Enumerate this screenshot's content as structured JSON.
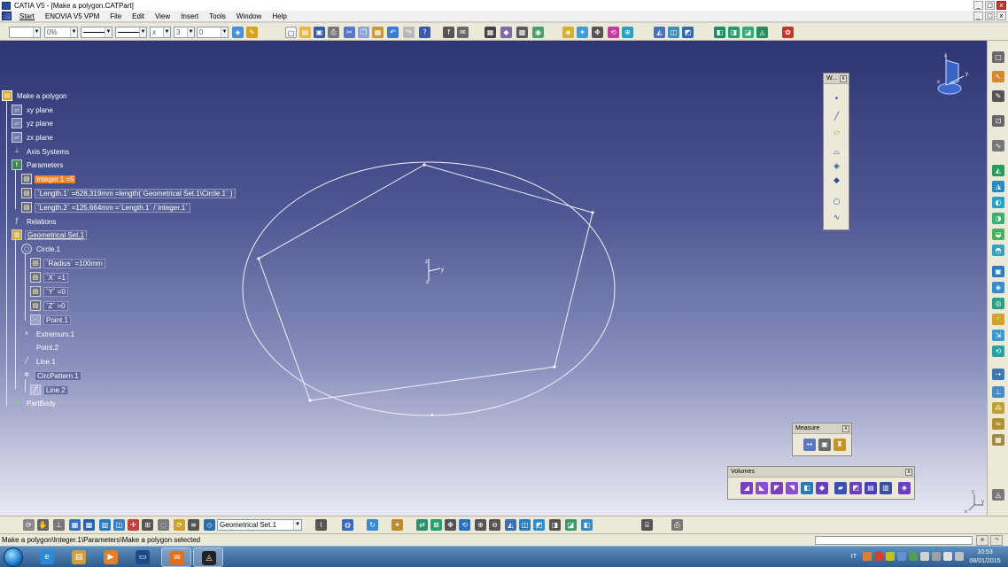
{
  "window": {
    "title": "CATIA V5 - [Make a polygon.CATPart]",
    "min": "_",
    "max": "□",
    "close": "x"
  },
  "menu": {
    "items": [
      "Start",
      "ENOVIA V5 VPM",
      "File",
      "Edit",
      "View",
      "Insert",
      "Tools",
      "Window",
      "Help"
    ]
  },
  "toolbar": {
    "transparency": "0%",
    "layer_value": "3",
    "thickness_value": "0",
    "none_value": "x"
  },
  "tree": {
    "root": "Make a polygon",
    "xy_plane": "xy plane",
    "yz_plane": "yz plane",
    "zx_plane": "zx plane",
    "axis_systems": "Axis Systems",
    "parameters": "Parameters",
    "integer1": "Integer.1 =5",
    "length1": "`Length.1` =628,319mm =length(`Geometrical Set.1\\Circle.1` )",
    "length2": "`Length.2` =125,664mm =`Length.1` /`Integer.1`",
    "relations": "Relations",
    "geometrical_set": "Geometrical Set.1",
    "circle1": "Circle.1",
    "radius": "`Radius` =100mm",
    "x": "`X` =1",
    "y": "`Y` =0",
    "z": "`Z` =0",
    "point1": "Point.1",
    "extremum1": "Extremum.1",
    "point2": "Point.2",
    "line1": "Line.1",
    "circpattern1": "CircPattern.1",
    "line2": "Line.2",
    "partbody": "PartBody"
  },
  "axis_labels": {
    "compass_x": "x",
    "compass_y": "y",
    "compass_z": "z",
    "origin_x": "x",
    "origin_y": "y",
    "origin_z": "z",
    "corner_x": "x",
    "corner_y": "y",
    "corner_z": "z"
  },
  "panels": {
    "wireframe_title": "W...",
    "measure_title": "Measure",
    "volumes_title": "Volumes",
    "close_glyph": "x"
  },
  "bottom_toolbar": {
    "current_set": "Geometrical Set.1"
  },
  "status": {
    "message": "Make a polygon\\Integer.1\\Parameters\\Make a polygon selected"
  },
  "taskbar": {
    "language": "IT",
    "time": "10:53",
    "date": "08/01/2015"
  },
  "colors": {
    "selection": "#f58220",
    "viewport_top": "#2f3573",
    "viewport_bottom": "#e8e9f2",
    "geometry": "#ffffff"
  }
}
